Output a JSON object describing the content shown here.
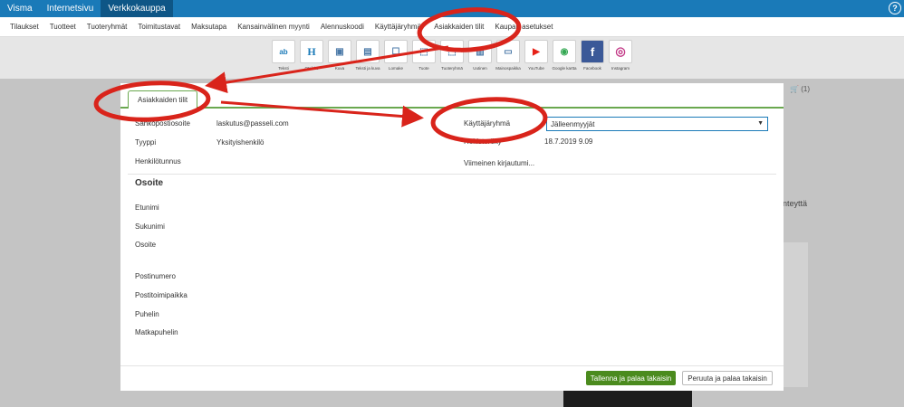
{
  "topbar": {
    "tabs": [
      "Visma",
      "Internetsivu",
      "Verkkokauppa"
    ],
    "active_index": 2,
    "help_label": "?"
  },
  "menu": [
    "Tilaukset",
    "Tuotteet",
    "Tuoteryhmät",
    "Toimitustavat",
    "Maksutapa",
    "Kansainvälinen myynti",
    "Alennuskoodi",
    "Käyttäjäryhmät",
    "Asiakkaiden tilit",
    "Kaupan asetukset"
  ],
  "toolbar": [
    {
      "icon": "text-icon",
      "glyph": "ab",
      "label": "Teksti"
    },
    {
      "icon": "heading-icon",
      "glyph": "H",
      "label": "Otsikko"
    },
    {
      "icon": "image-icon",
      "glyph": "▣",
      "label": "Kuva"
    },
    {
      "icon": "text-image-icon",
      "glyph": "▤",
      "label": "Teksti ja kuva"
    },
    {
      "icon": "form-icon",
      "glyph": "☐",
      "label": "Lomake"
    },
    {
      "icon": "product-icon",
      "glyph": "⬚",
      "label": "Tuote"
    },
    {
      "icon": "product-group-icon",
      "glyph": "⬚",
      "label": "Tuoteryhmä"
    },
    {
      "icon": "news-icon",
      "glyph": "▥",
      "label": "Uutinen"
    },
    {
      "icon": "ad-space-icon",
      "glyph": "▭",
      "label": "Mainospaikka"
    },
    {
      "icon": "youtube-icon",
      "glyph": "▶",
      "label": "YouTube"
    },
    {
      "icon": "google-maps-icon",
      "glyph": "◉",
      "label": "Google kartta"
    },
    {
      "icon": "facebook-icon",
      "glyph": "f",
      "label": "Facebook"
    },
    {
      "icon": "instagram-icon",
      "glyph": "◎",
      "label": "Instagram"
    }
  ],
  "background": {
    "cart_count": "(1)",
    "partial_text": "nteyttä"
  },
  "modal": {
    "tab_label": "Asiakkaiden tilit",
    "fields_left": [
      {
        "label": "Sähköpostiosoite",
        "value": "laskutus@passeli.com"
      },
      {
        "label": "Tyyppi",
        "value": "Yksityishenkilö"
      },
      {
        "label": "Henkilötunnus",
        "value": ""
      }
    ],
    "fields_right": [
      {
        "label": "Käyttäjäryhmä",
        "value": "Jälleenmyyjät"
      },
      {
        "label": "Rekisteröity",
        "value": "18.7.2019 9.09"
      },
      {
        "label": "Viimeinen kirjautumi...",
        "value": ""
      }
    ],
    "address_title": "Osoite",
    "address_fields": [
      "Etunimi",
      "Sukunimi",
      "Osoite",
      "Postinumero",
      "Postitoimipaikka",
      "Puhelin",
      "Matkapuhelin"
    ],
    "save_label": "Tallenna ja palaa takaisin",
    "cancel_label": "Peruuta ja palaa takaisin"
  },
  "colors": {
    "topbar": "#1a7ab8",
    "topbar_active": "#0e5686",
    "accent_green": "#6aa84f",
    "save_button": "#4b8b1e",
    "annotation_red": "#d9241b"
  }
}
